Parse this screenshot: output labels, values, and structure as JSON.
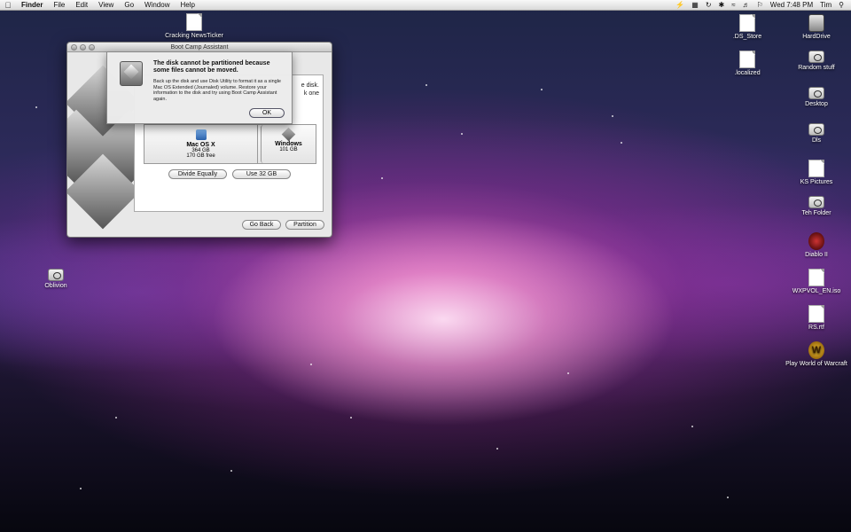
{
  "menubar": {
    "items": [
      "Finder",
      "File",
      "Edit",
      "View",
      "Go",
      "Window",
      "Help"
    ],
    "clock": "Wed 7:48 PM",
    "user": "Tim"
  },
  "desktop_icons_left": [
    {
      "label": "Cracking NewsTicker"
    },
    {
      "label": "Oblivion"
    }
  ],
  "desktop_icons_right": [
    {
      "label": ".DS_Store"
    },
    {
      "label": "HardDrive"
    },
    {
      "label": ".localized"
    },
    {
      "label": "Random stuff"
    },
    {
      "label": "Desktop"
    },
    {
      "label": "Dls"
    },
    {
      "label": "KS Pictures"
    },
    {
      "label": "Teh Folder"
    },
    {
      "label": "Diablo II"
    },
    {
      "label": "WXPVOL_EN.iso"
    },
    {
      "label": "RS.rtf"
    },
    {
      "label": "Play World of Warcraft"
    }
  ],
  "window": {
    "title": "Boot Camp Assistant",
    "panel_text_1": "e disk.",
    "panel_text_2": "k one",
    "partitions": {
      "mac": {
        "name": "Mac OS X",
        "size": "364 GB",
        "free": "170 GB free"
      },
      "windows": {
        "name": "Windows",
        "size": "101 GB"
      }
    },
    "divide_label": "Divide Equally",
    "use32_label": "Use 32 GB",
    "back_label": "Go Back",
    "partition_label": "Partition"
  },
  "alert": {
    "title": "The disk cannot be partitioned because some files cannot be moved.",
    "message": "Back up the disk and use Disk Utility to format it as a single Mac OS Extended (Journaled) volume. Restore your information to the disk and try using Boot Camp Assistant again.",
    "ok_label": "OK"
  }
}
